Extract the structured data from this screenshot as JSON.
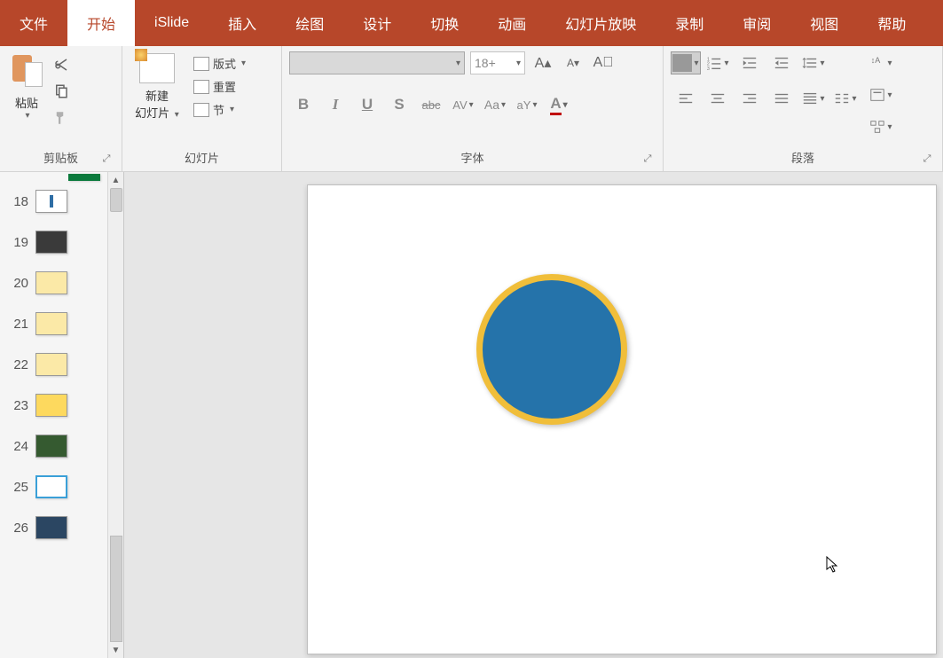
{
  "menubar": {
    "tabs": [
      {
        "label": "文件"
      },
      {
        "label": "开始"
      },
      {
        "label": "iSlide"
      },
      {
        "label": "插入"
      },
      {
        "label": "绘图"
      },
      {
        "label": "设计"
      },
      {
        "label": "切换"
      },
      {
        "label": "动画"
      },
      {
        "label": "幻灯片放映"
      },
      {
        "label": "录制"
      },
      {
        "label": "审阅"
      },
      {
        "label": "视图"
      },
      {
        "label": "帮助"
      }
    ],
    "active_index": 1
  },
  "ribbon": {
    "clipboard": {
      "paste_label": "粘贴",
      "group_label": "剪贴板"
    },
    "slides": {
      "newslide_line1": "新建",
      "newslide_line2": "幻灯片",
      "layout_label": "版式",
      "reset_label": "重置",
      "section_label": "节",
      "group_label": "幻灯片"
    },
    "font": {
      "size_placeholder": "18+",
      "group_label": "字体",
      "bold": "B",
      "italic": "I",
      "underline": "U",
      "shadow": "S",
      "strike": "abc",
      "spacing": "AV",
      "case": "Aa",
      "highlight": "aY",
      "color": "A"
    },
    "paragraph": {
      "group_label": "段落"
    }
  },
  "thumbnails": {
    "items": [
      {
        "num": "18"
      },
      {
        "num": "19"
      },
      {
        "num": "20"
      },
      {
        "num": "21"
      },
      {
        "num": "22"
      },
      {
        "num": "23"
      },
      {
        "num": "24"
      },
      {
        "num": "25"
      },
      {
        "num": "26"
      }
    ]
  },
  "canvas": {
    "shape_fill": "#2573aa",
    "shape_stroke": "#f0be3a"
  }
}
